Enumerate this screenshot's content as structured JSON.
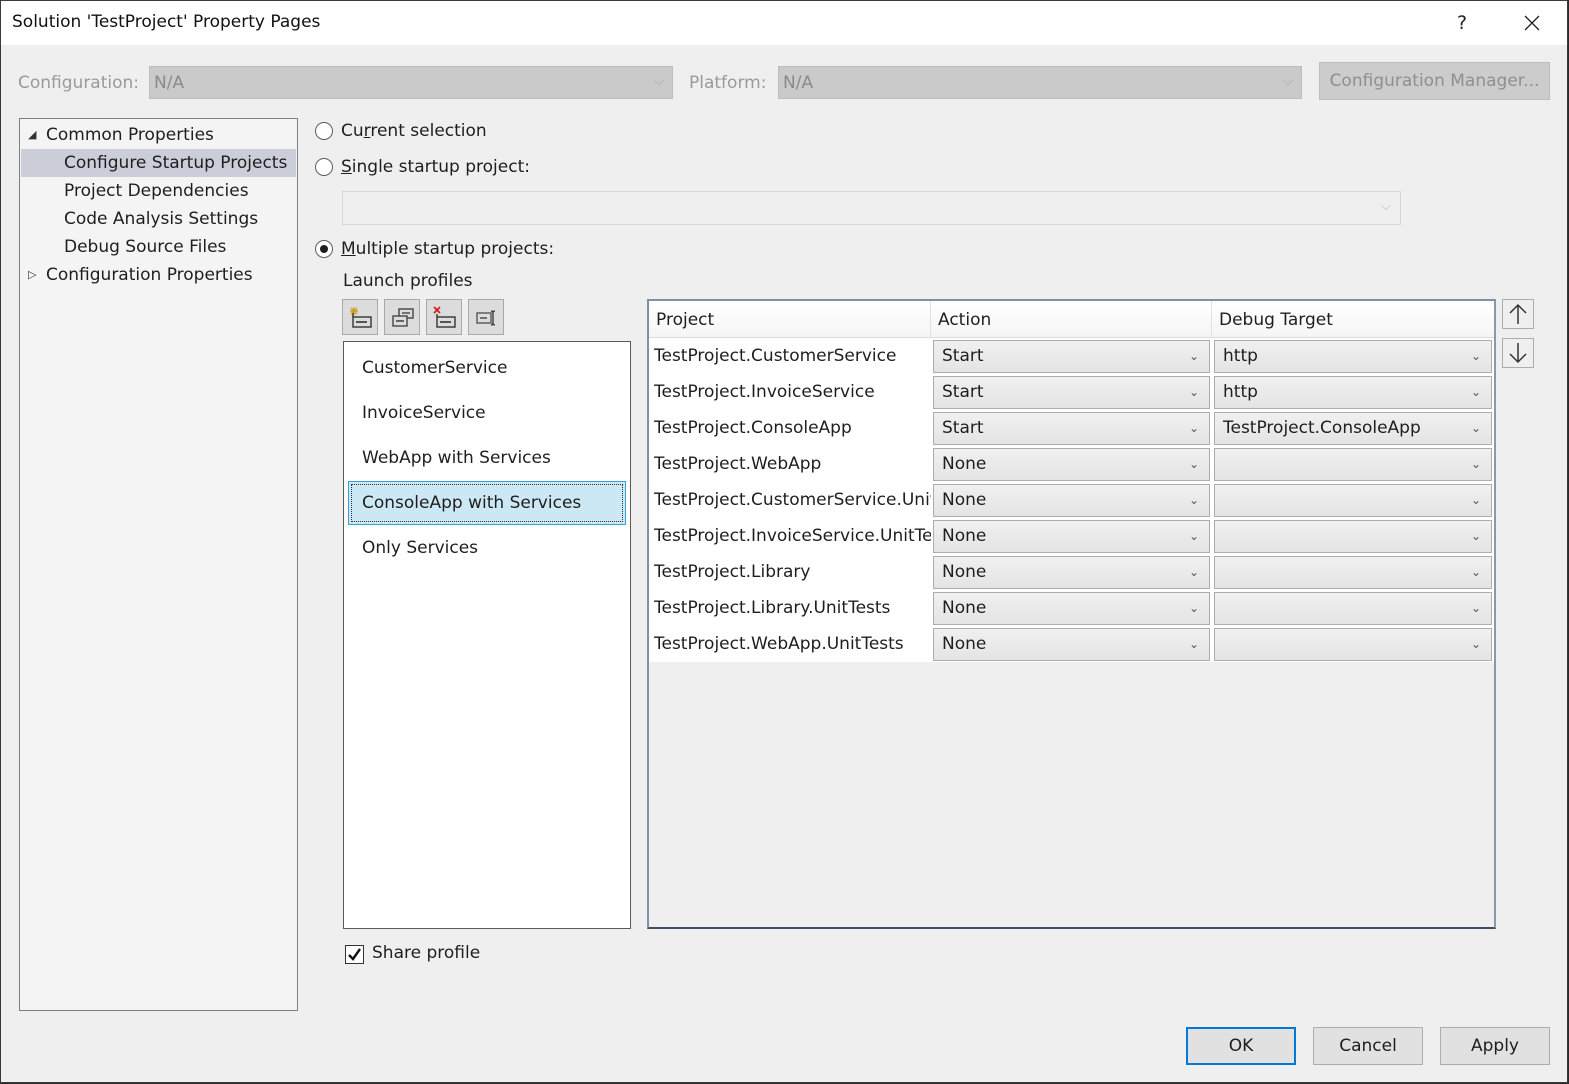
{
  "window": {
    "title": "Solution 'TestProject' Property Pages",
    "help_label": "?",
    "close_label": "✕"
  },
  "config_bar": {
    "configuration_label": "Configuration:",
    "configuration_value": "N/A",
    "platform_label": "Platform:",
    "platform_value": "N/A",
    "config_manager_label": "Configuration Manager...",
    "chevron": "⌵"
  },
  "tree": {
    "items": [
      {
        "label": "Common Properties",
        "expander": "◢",
        "level": 0,
        "expanded": true
      },
      {
        "label": "Configure Startup Projects",
        "level": 1,
        "selected": true
      },
      {
        "label": "Project Dependencies",
        "level": 1
      },
      {
        "label": "Code Analysis Settings",
        "level": 1
      },
      {
        "label": "Debug Source Files",
        "level": 1
      },
      {
        "label": "Configuration Properties",
        "expander": "▷",
        "level": 0,
        "expanded": false
      }
    ]
  },
  "startup": {
    "current_selection": {
      "pre": "Cu",
      "u": "r",
      "post": "rent selection",
      "checked": false
    },
    "single_startup": {
      "pre": "",
      "u": "S",
      "post": "ingle startup project:",
      "checked": false,
      "value": ""
    },
    "multiple_startup": {
      "pre": "",
      "u": "M",
      "post": "ultiple startup projects:",
      "checked": true
    }
  },
  "launch_profiles": {
    "label": "Launch profiles",
    "toolbar": [
      {
        "name": "new-profile",
        "tooltip": "New profile"
      },
      {
        "name": "copy-profile",
        "tooltip": "Copy profile"
      },
      {
        "name": "delete-profile",
        "tooltip": "Delete profile"
      },
      {
        "name": "rename-profile",
        "tooltip": "Rename profile"
      }
    ],
    "items": [
      {
        "label": "CustomerService"
      },
      {
        "label": "InvoiceService"
      },
      {
        "label": "WebApp with Services"
      },
      {
        "label": "ConsoleApp with Services",
        "selected": true
      },
      {
        "label": "Only Services"
      }
    ],
    "share_profile": {
      "label": "Share profile",
      "checked": true
    }
  },
  "grid": {
    "headers": [
      "Project",
      "Action",
      "Debug Target"
    ],
    "rows": [
      {
        "project": "TestProject.CustomerService",
        "action": "Start",
        "target": "http"
      },
      {
        "project": "TestProject.InvoiceService",
        "action": "Start",
        "target": "http"
      },
      {
        "project": "TestProject.ConsoleApp",
        "action": "Start",
        "target": "TestProject.ConsoleApp"
      },
      {
        "project": "TestProject.WebApp",
        "action": "None",
        "target": ""
      },
      {
        "project": "TestProject.CustomerService.UnitTests",
        "action": "None",
        "target": ""
      },
      {
        "project": "TestProject.InvoiceService.UnitTests",
        "action": "None",
        "target": ""
      },
      {
        "project": "TestProject.Library",
        "action": "None",
        "target": ""
      },
      {
        "project": "TestProject.Library.UnitTests",
        "action": "None",
        "target": ""
      },
      {
        "project": "TestProject.WebApp.UnitTests",
        "action": "None",
        "target": ""
      }
    ],
    "move_up_label": "↑",
    "move_down_label": "↓"
  },
  "buttons": {
    "ok": "OK",
    "cancel": "Cancel",
    "apply": "Apply"
  },
  "colors": {
    "accent": "#0078d7",
    "selection_bg": "#cce8f5",
    "tree_selection_bg": "#cbcdd8"
  }
}
